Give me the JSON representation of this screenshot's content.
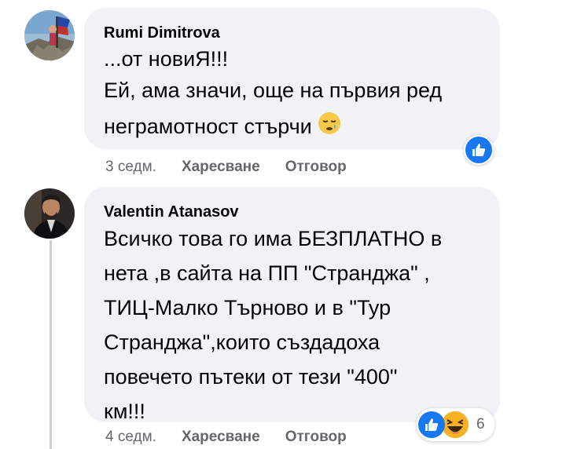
{
  "comments": [
    {
      "author": "Rumi Dimitrova",
      "lines": [
        "...от новиЯ!!!",
        "Ей, ама значи, още на първия ред",
        "неграмотност стърчи"
      ],
      "time": "3 седм.",
      "like_label": "Харесване",
      "reply_label": "Отговор",
      "reaction_icons": [
        "like-icon"
      ]
    },
    {
      "author": "Valentin Atanasov",
      "lines": [
        "Всичко това го има БЕЗПЛАТНО в",
        "нета ,в сайта на ПП \"Странджа\" ,",
        "ТИЦ-Малко Търново и в \"Тур",
        "Странджа\",които създадоха",
        "повечето пътеки от тези \"400\"",
        "км!!!"
      ],
      "time": "4 седм.",
      "like_label": "Харесване",
      "reply_label": "Отговор",
      "reaction_count": "6",
      "reaction_icons": [
        "like-icon",
        "haha-icon"
      ]
    }
  ],
  "colors": {
    "bubble": "#f0f2f5",
    "like_blue": "#1877f2",
    "meta_gray": "#65676b",
    "haha_yellow": "#f7b125"
  }
}
